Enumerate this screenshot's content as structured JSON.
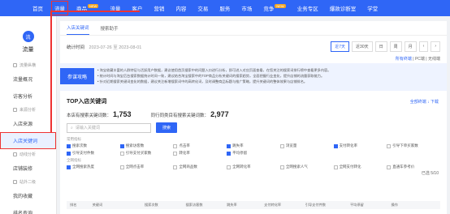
{
  "topnav": {
    "items": [
      {
        "label": "首页",
        "active": false,
        "badge": ""
      },
      {
        "label": "流量",
        "active": true,
        "badge": ""
      },
      {
        "label": "商品",
        "active": false,
        "badge": "NEW"
      },
      {
        "label": "流量",
        "active": false,
        "badge": ""
      },
      {
        "label": "客户",
        "active": false,
        "badge": ""
      },
      {
        "label": "营销",
        "active": false,
        "badge": ""
      },
      {
        "label": "内容",
        "active": false,
        "badge": ""
      },
      {
        "label": "交易",
        "active": false,
        "badge": ""
      },
      {
        "label": "服务",
        "active": false,
        "badge": ""
      },
      {
        "label": "市场",
        "active": false,
        "badge": ""
      },
      {
        "label": "竞争",
        "active": false,
        "badge": "NEW"
      },
      {
        "label": "业务专区",
        "active": false,
        "badge": ""
      },
      {
        "label": "爆款诊断室",
        "active": false,
        "badge": ""
      },
      {
        "label": "学堂",
        "active": false,
        "badge": ""
      }
    ]
  },
  "sidebar": {
    "logo": "流",
    "title": "流量",
    "items": [
      {
        "type": "section",
        "label": "流量纵横"
      },
      {
        "type": "nav",
        "label": "流量概况"
      },
      {
        "type": "nav",
        "label": "访客分析"
      },
      {
        "type": "section",
        "label": "来源分析"
      },
      {
        "type": "nav",
        "label": "入店来源"
      },
      {
        "type": "nav",
        "label": "入店关键词",
        "active": true
      },
      {
        "type": "section",
        "label": "动线分析"
      },
      {
        "type": "nav",
        "label": "店铺装修"
      },
      {
        "type": "section",
        "label": "站外二级"
      },
      {
        "type": "nav",
        "label": "我的收藏"
      },
      {
        "type": "nav",
        "label": "排名查询"
      }
    ]
  },
  "tabs": [
    "入店关键词",
    "搜索助手"
  ],
  "date": {
    "label": "统计时间",
    "range": "2023-07-26 至 2023-08-01"
  },
  "dateops": [
    "近7天",
    "近30天",
    "日",
    "周",
    "月",
    "‹",
    "›"
  ],
  "links": {
    "primary": "所有终端",
    "pc": "PC端",
    "wireless": "无线端"
  },
  "notice": {
    "badge": "参谋攻略",
    "line1": "• 淘宝收藏丰富的人群特征与活跃用户数据，建议使用首页搜索中的问题入口进行分析，即可进入对应页面查看，在您关注的搜索词排行榜中查看更多内容。",
    "line2": "• 统计时间与淘宝后台搜索数据统计时间一致，建议结合淘宝搜索中的TOP商品分析关键词的搜索趋势，全面把握行业变化，提升店铺的流量获取能力。",
    "line3": "• 针对近期搜索关键词变化的数据，建议关注新增搜索词中的高转化词，及时调整商品标题与推广策略，提升关键词的整体效果与店铺排名。"
  },
  "section": {
    "title": "TOP入店关键词",
    "ops": "全部终端 ↓ 下载"
  },
  "stats": {
    "label1": "本店有搜索关键词数：",
    "value1": "1,753",
    "label2": "同行同类目有搜索关键词数：",
    "value2": "2,977"
  },
  "search": {
    "placeholder": "请输入关键词",
    "button": "搜索"
  },
  "filters": {
    "group1_label": "常用指标",
    "group1": [
      {
        "label": "搜索次数",
        "on": true
      },
      {
        "label": "搜索访客数",
        "on": true
      },
      {
        "label": "点击率",
        "on": false
      },
      {
        "label": "跳失率",
        "on": true
      },
      {
        "label": "浏览量",
        "on": false
      },
      {
        "label": "支付转化率",
        "on": true
      },
      {
        "label": "引导下单买家数",
        "on": false
      },
      {
        "label": "引导支付件数",
        "on": true
      },
      {
        "label": "引导支付买家数",
        "on": false
      },
      {
        "label": "转化率",
        "on": false
      },
      {
        "label": "平均停留",
        "on": true
      }
    ],
    "group2_label": "全网指标",
    "group2": [
      {
        "label": "全网搜索热度",
        "on": true
      },
      {
        "label": "全网点击率",
        "on": false
      },
      {
        "label": "全网商品数",
        "on": false
      },
      {
        "label": "全网转化率",
        "on": false
      },
      {
        "label": "全网搜索人气",
        "on": false
      },
      {
        "label": "全网支付转化",
        "on": false
      },
      {
        "label": "直通车参考价",
        "on": false
      }
    ],
    "export": "已选 5/10"
  },
  "table": {
    "headers": [
      "排名",
      "关键词",
      "搜索次数",
      "搜索访客数",
      "跳失率",
      "支付转化率",
      "引导支付件数",
      "平均停留",
      "操作"
    ]
  }
}
